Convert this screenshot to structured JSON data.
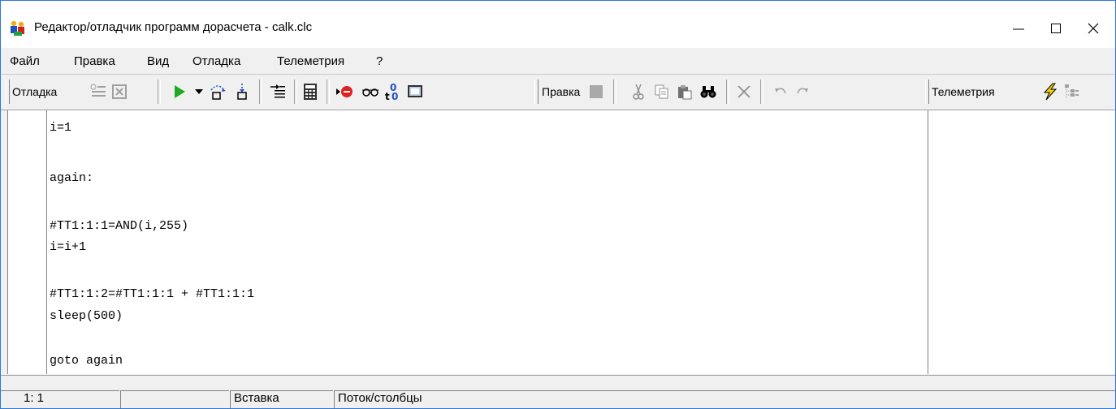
{
  "window": {
    "title": "Редактор/отладчик программ дорасчета - calk.clc",
    "icon": "app-people-icon"
  },
  "menu": [
    {
      "label": "Файл"
    },
    {
      "label": "Правка"
    },
    {
      "label": "Вид"
    },
    {
      "label": "Отладка"
    },
    {
      "label": "Телеметрия"
    },
    {
      "label": "?"
    }
  ],
  "toolbar": {
    "debug_label": "Отладка",
    "edit_label": "Правка",
    "telemetry_label": "Телеметрия",
    "icons": {
      "debug": [
        "breakpoint-list-icon",
        "clear-icon",
        "run-icon",
        "run-dropdown-icon",
        "step-into-icon",
        "step-over-icon",
        "run-to-cursor-icon",
        "calculator-icon",
        "stop-icon",
        "watch-icon",
        "variables-icon",
        "monitor-icon"
      ],
      "edit": [
        "save-icon",
        "cut-icon",
        "copy-icon",
        "paste-icon",
        "find-icon",
        "delete-icon",
        "undo-icon",
        "redo-icon"
      ],
      "telemetry": [
        "lightning-icon",
        "tree-icon"
      ]
    }
  },
  "editor": {
    "lines": [
      "i=1",
      "",
      "again:",
      "",
      "#TT1:1:1=AND(i,255)",
      "i=i+1",
      "",
      "#TT1:1:2=#TT1:1:1 + #TT1:1:1",
      "sleep(500)",
      "",
      "goto again"
    ]
  },
  "status": {
    "position": "1:  1",
    "empty": "",
    "mode": "Вставка",
    "stream": "Поток/столбцы"
  },
  "colors": {
    "window_border": "#2b79d8",
    "chrome_bg": "#f0f0f0",
    "editor_bg": "#ffffff",
    "run_green": "#22a822",
    "stop_red": "#e02020"
  }
}
